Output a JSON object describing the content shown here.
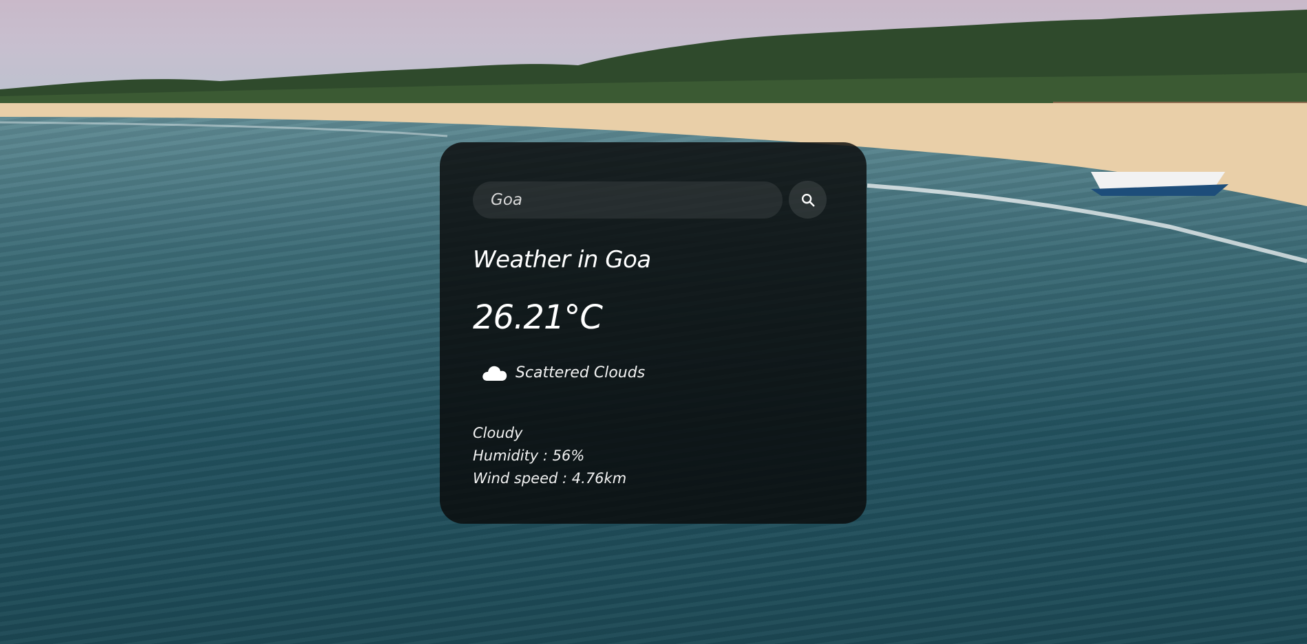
{
  "search": {
    "value": "Goa",
    "icon": "search-icon"
  },
  "weather": {
    "title": "Weather in Goa",
    "temperature": "26.21°C",
    "icon": "cloud-icon",
    "description": "Scattered Clouds",
    "condition": "Cloudy",
    "humidity": "Humidity : 56%",
    "wind": "Wind speed : 4.76km"
  },
  "colors": {
    "card_background": "#0a0a0a",
    "text": "#ffffff",
    "sea": "#23525f",
    "sand": "#e9cfa8"
  }
}
